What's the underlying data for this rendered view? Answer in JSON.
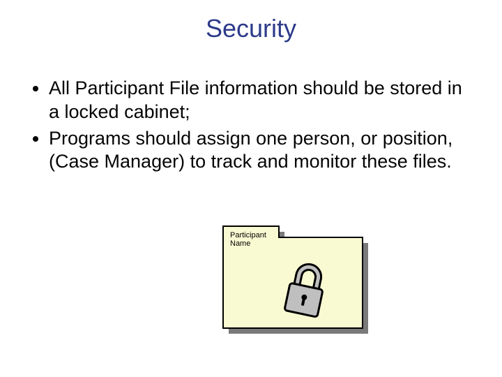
{
  "title": "Security",
  "bullets": [
    "All Participant File information should be stored in a locked cabinet;",
    "Programs should assign one person, or position, (Case Manager) to track and monitor these files."
  ],
  "folder": {
    "tab_line1": "Participant",
    "tab_line2": "Name"
  }
}
